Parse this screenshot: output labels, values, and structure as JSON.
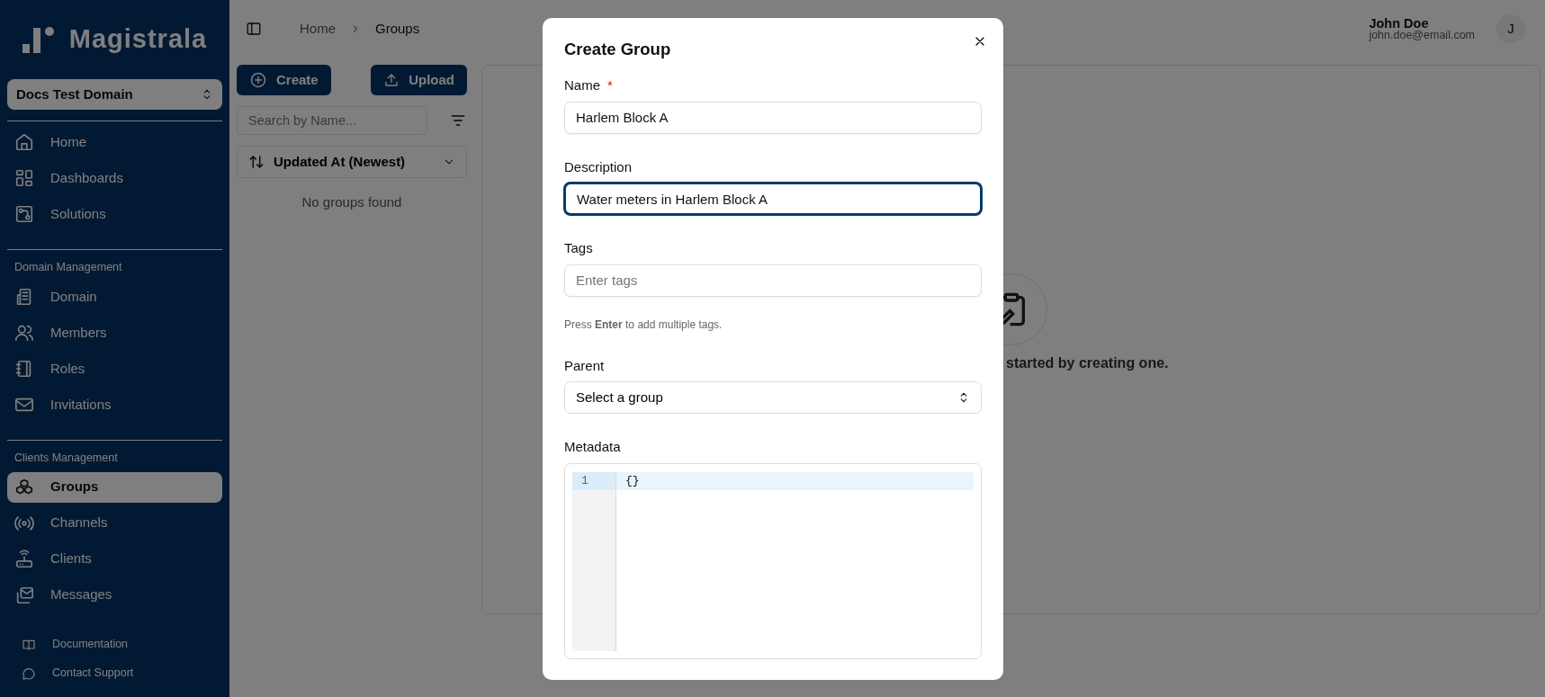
{
  "sidebar": {
    "logo": "Magistrala",
    "domain_selector": "Docs Test Domain",
    "nav_groups": [
      {
        "items": [
          {
            "label": "Home",
            "selected": false
          },
          {
            "label": "Dashboards",
            "selected": false
          },
          {
            "label": "Solutions",
            "selected": false
          }
        ]
      },
      {
        "heading": "Domain Management",
        "items": [
          {
            "label": "Domain",
            "selected": false
          },
          {
            "label": "Members",
            "selected": false
          },
          {
            "label": "Roles",
            "selected": false
          },
          {
            "label": "Invitations",
            "selected": false
          }
        ]
      },
      {
        "heading": "Clients Management",
        "items": [
          {
            "label": "Groups",
            "selected": true
          },
          {
            "label": "Channels",
            "selected": false
          },
          {
            "label": "Clients",
            "selected": false
          },
          {
            "label": "Messages",
            "selected": false
          }
        ]
      }
    ],
    "footer_links": [
      "Documentation",
      "Contact Support"
    ]
  },
  "header": {
    "breadcrumb": [
      "Home",
      "Groups"
    ],
    "user": {
      "name": "John Doe",
      "email": "john.doe@email.com",
      "avatar": "J"
    }
  },
  "groups_panel": {
    "create_button": "Create",
    "upload_button": "Upload",
    "search": {
      "placeholder": "Search by Name..."
    },
    "sort": "Updated At (Newest)",
    "empty_text": "No groups found"
  },
  "main_panel": {
    "empty_text": "started by creating one."
  },
  "dialog": {
    "title": "Create Group",
    "fields": [
      {
        "kind": "text",
        "label": "Name",
        "required_mark": "*",
        "focused": false,
        "value": "Harlem Block A"
      },
      {
        "kind": "text",
        "label": "Description",
        "focused": true,
        "value": "Water meters in Harlem Block A"
      },
      {
        "kind": "text",
        "label": "Tags",
        "focused": false,
        "placeholder": "Enter tags",
        "hint": "Press **Enter** to add multiple tags."
      },
      {
        "kind": "select",
        "label": "Parent",
        "focused": false,
        "value": "Select a group"
      },
      {
        "kind": "code",
        "label": "Metadata",
        "focused": false,
        "lines": [
          {
            "number": "1",
            "text": "{}",
            "active": true
          }
        ]
      }
    ]
  }
}
